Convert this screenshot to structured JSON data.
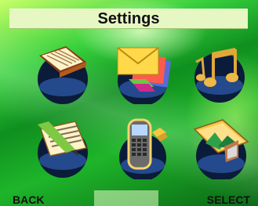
{
  "header": {
    "title": "Settings"
  },
  "grid": {
    "items": [
      {
        "icon": "book-icon"
      },
      {
        "icon": "envelope-icon"
      },
      {
        "icon": "music-note-icon"
      },
      {
        "icon": "notepad-icon"
      },
      {
        "icon": "phone-icon"
      },
      {
        "icon": "image-icon"
      }
    ]
  },
  "softkeys": {
    "left": "BACK",
    "right": "SELECT"
  },
  "colors": {
    "title_bg": "#e6f7c3",
    "bg_green": "#1eb52a",
    "globe_dark": "#0b1b3a"
  }
}
